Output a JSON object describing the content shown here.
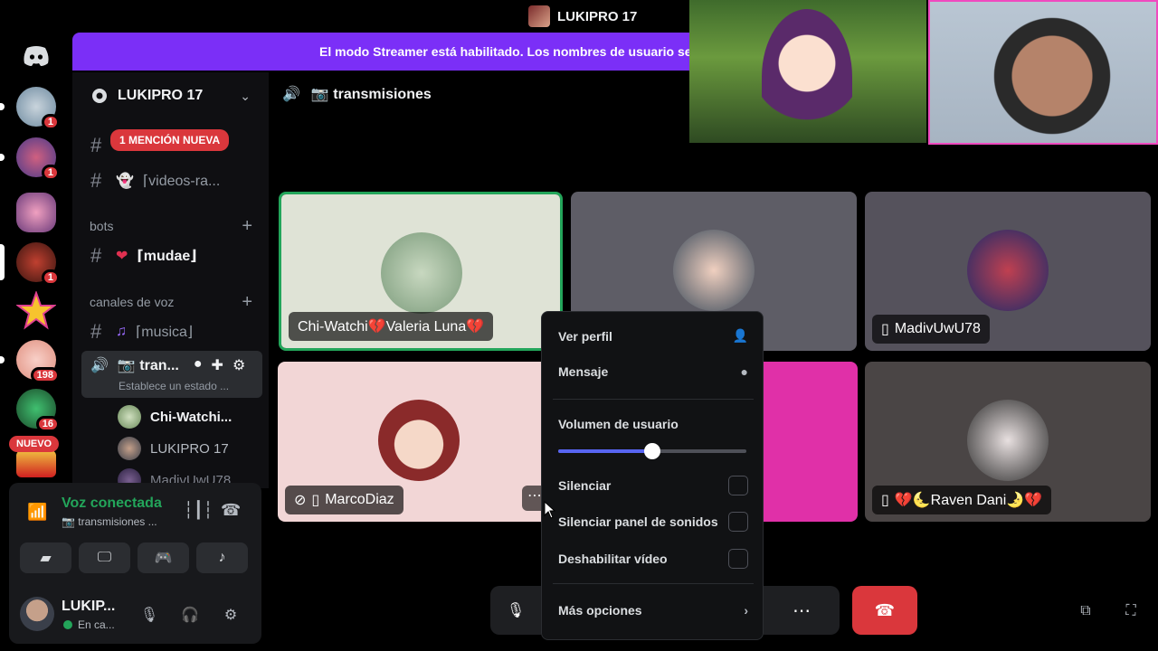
{
  "window": {
    "title": "LUKIPRO 17"
  },
  "banner": {
    "text": "El modo Streamer está habilitado. Los nombres de usuario se"
  },
  "rail": {
    "servers": [
      {
        "badge": "1",
        "color": "#8aa3b8"
      },
      {
        "badge": "1",
        "color": "#6d5fa8"
      },
      {
        "badge": "",
        "color": "#c05a8a"
      },
      {
        "badge": "1",
        "color": "#7a2b1e"
      },
      {
        "badge": "",
        "color": "#f0c040"
      },
      {
        "badge": "198",
        "color": "#e8b0a0"
      },
      {
        "badge": "16",
        "color": "#2e8b57"
      }
    ],
    "new_label": "NUEVO"
  },
  "guild": {
    "name": "LUKIPRO 17",
    "mention_badge": "1 MENCIÓN NUEVA",
    "channels": {
      "videos": "⌈videos-ra...",
      "mudae": "⌈mudae⌋",
      "musica": "⌈musica⌋",
      "transmisiones": "📷 tran...",
      "transmisiones_status": "Establece un estado ..."
    },
    "categories": {
      "bots": "bots",
      "voz": "canales de voz"
    },
    "voice_users": [
      "Chi-Watchi...",
      "LUKIPRO 17",
      "MadivUwU78"
    ]
  },
  "voice": {
    "title": "Voz conectada",
    "channel": "📷 transmisiones ..."
  },
  "user": {
    "name": "LUKIP...",
    "status": "En ca..."
  },
  "channel_header": {
    "name": "📷 transmisiones"
  },
  "tiles": [
    {
      "label": "Chi-Watchi💔Valeria Luna💔",
      "bg": "#dfe3d6"
    },
    {
      "label": "",
      "bg": "#5e5d66"
    },
    {
      "label": "MadivUwU78",
      "bg": "#55525c"
    },
    {
      "label": "MarcoDiaz",
      "bg": "#f2d6d6"
    },
    {
      "label": "",
      "bg": "#e030a8"
    },
    {
      "label": "💔🌜Raven Dani🌛💔",
      "bg": "#4a4545"
    }
  ],
  "menu": {
    "ver_perfil": "Ver perfil",
    "mensaje": "Mensaje",
    "volumen": "Volumen de usuario",
    "volume_fraction": 0.5,
    "silenciar": "Silenciar",
    "silenciar_panel": "Silenciar panel de sonidos",
    "deshabilitar_video": "Deshabilitar vídeo",
    "mas_opciones": "Más opciones"
  },
  "colors": {
    "accent": "#5865f2",
    "danger": "#da373c",
    "green": "#23a55a",
    "streamer": "#7b2ff7"
  }
}
